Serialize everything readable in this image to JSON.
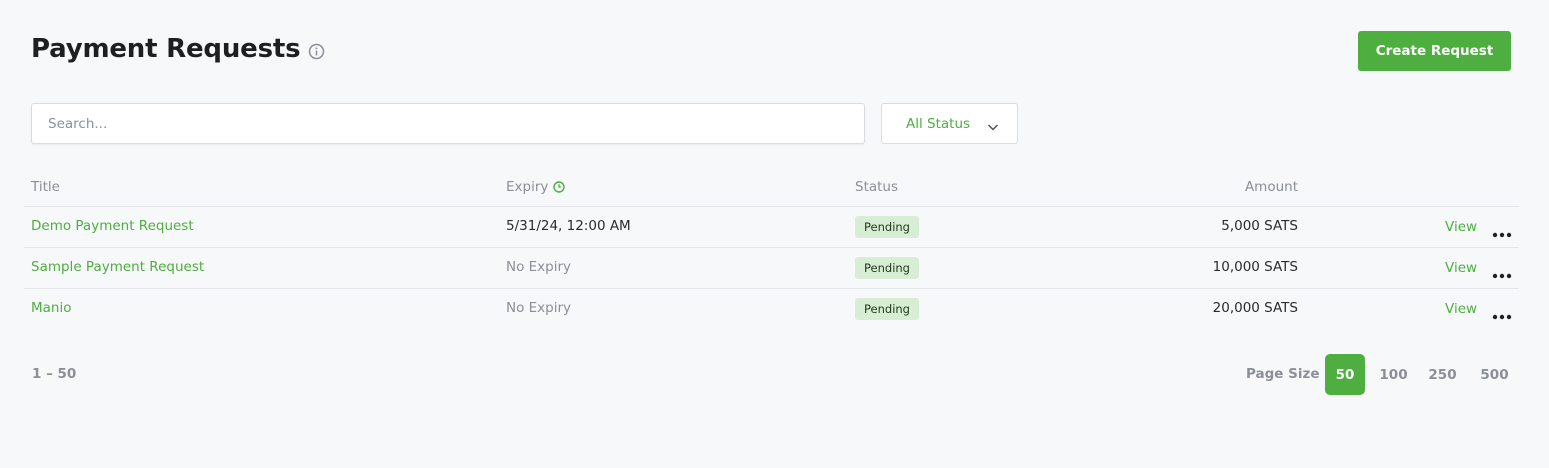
{
  "header": {
    "title": "Payment Requests",
    "create_label": "Create Request"
  },
  "search": {
    "placeholder": "Search..."
  },
  "filter": {
    "selected": "All Status"
  },
  "table": {
    "columns": [
      "Title",
      "Expiry",
      "Status",
      "Amount"
    ],
    "rows": [
      {
        "title": "Demo Payment Request",
        "expiry": "5/31/24, 12:00 AM",
        "status": "Pending",
        "amount": "5,000 SATS",
        "action": "View"
      },
      {
        "title": "Sample Payment Request",
        "expiry": "No Expiry",
        "status": "Pending",
        "amount": "10,000 SATS",
        "action": "View"
      },
      {
        "title": "Manio",
        "expiry": "No Expiry",
        "status": "Pending",
        "amount": "20,000 SATS",
        "action": "View"
      }
    ]
  },
  "pagination": {
    "range": "1 – 50",
    "page_size_label": "Page Size",
    "options": [
      "50",
      "100",
      "250",
      "500"
    ],
    "selected": "50"
  },
  "colors": {
    "accent": "#4eae3f",
    "badge_bg": "#d8eed4",
    "background": "#f7f8fa"
  }
}
